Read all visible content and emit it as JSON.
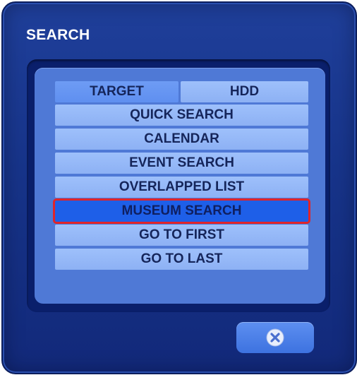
{
  "dialog": {
    "title": "SEARCH"
  },
  "target": {
    "label": "TARGET",
    "value": "HDD"
  },
  "menu": {
    "items": [
      {
        "label": "QUICK SEARCH"
      },
      {
        "label": "CALENDAR"
      },
      {
        "label": "EVENT SEARCH"
      },
      {
        "label": "OVERLAPPED LIST"
      },
      {
        "label": "MUSEUM SEARCH",
        "selected": true
      },
      {
        "label": "GO TO FIRST"
      },
      {
        "label": "GO TO LAST"
      }
    ]
  },
  "close_button": {
    "icon": "close-icon"
  },
  "colors": {
    "dialog_bg": "#17348a",
    "panel_bg": "#4f79d6",
    "row_bg": "#9ec0fb",
    "selected_bg": "#1e5fe8",
    "selected_border": "#e0242a",
    "text": "#15255a"
  }
}
